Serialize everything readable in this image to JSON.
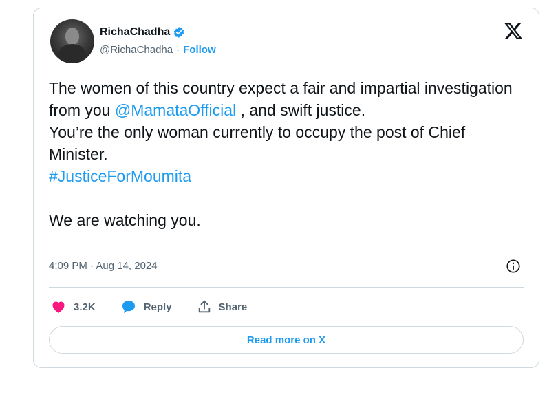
{
  "author": {
    "display_name": "RichaChadha",
    "handle": "@RichaChadha",
    "separator": "·",
    "follow_label": "Follow",
    "verified": true
  },
  "tweet": {
    "line1_before": "The women of this country expect a fair and impartial investigation from you ",
    "mention": "@MamataOfficial",
    "line1_after": " , and swift justice.",
    "line2": "You’re the only woman currently to occupy the post of Chief Minister.",
    "hashtag": "#JusticeForMoumita",
    "line3": "We are watching you.",
    "timestamp": "4:09 PM · Aug 14, 2024"
  },
  "actions": {
    "like_count": "3.2K",
    "reply_label": "Reply",
    "share_label": "Share"
  },
  "read_more_label": "Read more on X",
  "colors": {
    "accent": "#1d9bf0",
    "like": "#f91880",
    "text": "#0f1419",
    "muted": "#536471",
    "border": "#cfd9de"
  },
  "icons": [
    "verified-badge-icon",
    "x-logo-icon",
    "info-icon",
    "heart-icon",
    "reply-bubble-icon",
    "share-icon"
  ]
}
